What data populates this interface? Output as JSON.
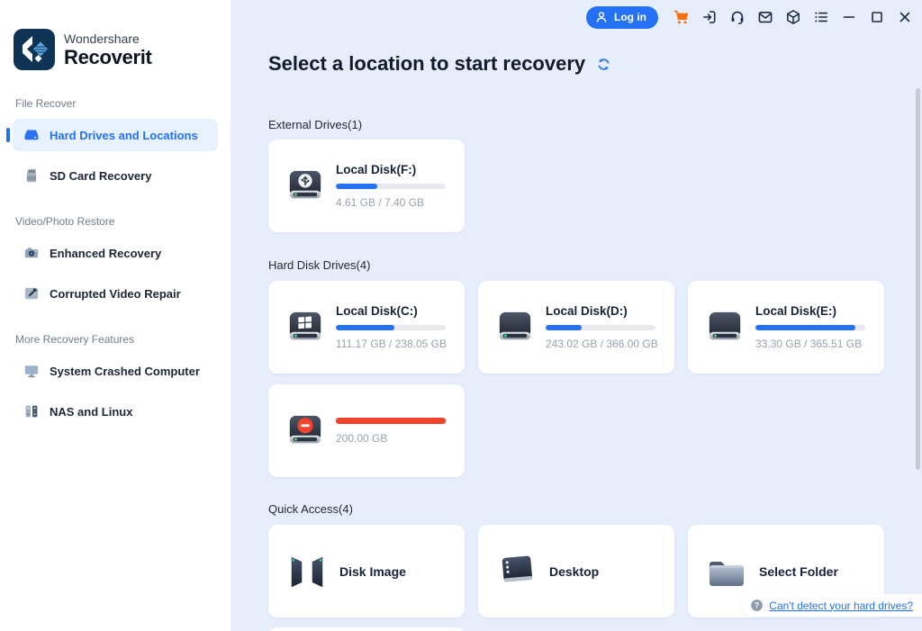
{
  "topbar": {
    "login_label": "Log in",
    "icons": [
      "cart-icon",
      "import-icon",
      "support-headset-icon",
      "mail-icon",
      "package-icon",
      "list-icon",
      "minimize-icon",
      "maximize-icon",
      "close-icon"
    ]
  },
  "sidebar": {
    "brand_line1": "Wondershare",
    "brand_line2": "Recoverit",
    "section_labels": [
      "File Recover",
      "Video/Photo Restore",
      "More Recovery Features"
    ],
    "items": [
      {
        "label": "Hard Drives and Locations",
        "active": true,
        "icon": "hard-drive-icon"
      },
      {
        "label": "SD Card Recovery",
        "active": false,
        "icon": "sd-card-icon"
      },
      {
        "label": "Enhanced Recovery",
        "active": false,
        "icon": "camera-icon"
      },
      {
        "label": "Corrupted Video Repair",
        "active": false,
        "icon": "video-repair-icon"
      },
      {
        "label": "System Crashed Computer",
        "active": false,
        "icon": "monitor-icon"
      },
      {
        "label": "NAS and Linux",
        "active": false,
        "icon": "nas-server-icon"
      }
    ]
  },
  "main": {
    "title": "Select a location to start recovery",
    "sections": {
      "external": {
        "label": "External Drives(1)"
      },
      "hdd": {
        "label": "Hard Disk Drives(4)"
      },
      "quick": {
        "label": "Quick Access(4)"
      }
    },
    "drives": {
      "f": {
        "name": "Local Disk(F:)",
        "size": "4.61 GB / 7.40 GB",
        "bar_width": "38%"
      },
      "c": {
        "name": "Local Disk(C:)",
        "size": "111.17 GB / 238.05 GB",
        "bar_width": "53%"
      },
      "d": {
        "name": "Local Disk(D:)",
        "size": "243.02 GB / 366.00 GB",
        "bar_width": "33%"
      },
      "e": {
        "name": "Local Disk(E:)",
        "size": "33.30 GB / 365.51 GB",
        "bar_width": "91%"
      },
      "unallocated": {
        "size": "200.00 GB",
        "bar_width": "100%"
      }
    },
    "quick_access": [
      {
        "label": "Disk Image",
        "icon": "disk-image-icon"
      },
      {
        "label": "Desktop",
        "icon": "desktop-icon"
      },
      {
        "label": "Select Folder",
        "icon": "folder-icon"
      }
    ],
    "help_link": "Can't detect your hard drives?"
  },
  "colors": {
    "accent": "#2571f5",
    "danger": "#f4432c",
    "cart": "#f5700d",
    "bar_track": "#e7e9ee",
    "main_bg": "#e6edfb",
    "active_item_bg": "#e8f1fe"
  }
}
